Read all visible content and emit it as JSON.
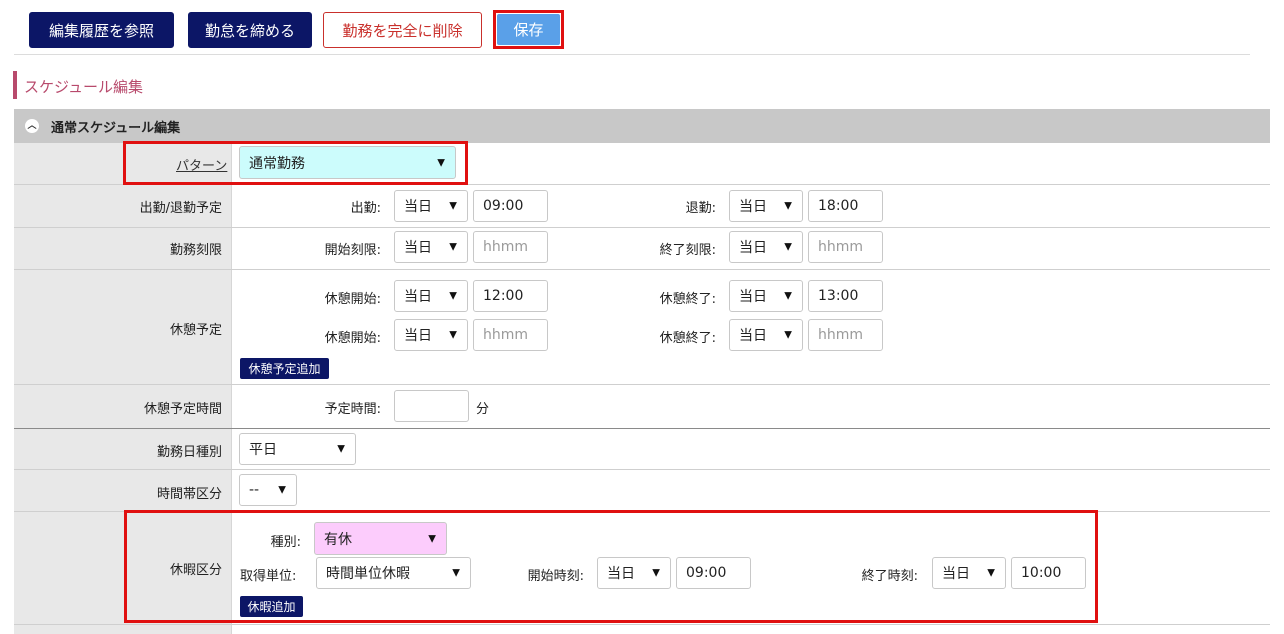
{
  "toolbar": {
    "history_label": "編集履歴を参照",
    "close_label": "勤怠を締める",
    "delete_label": "勤務を完全に削除",
    "save_label": "保存"
  },
  "section": {
    "title": "スケジュール編集"
  },
  "panel": {
    "title": "通常スケジュール編集"
  },
  "pattern": {
    "label": "パターン",
    "value": "通常勤務"
  },
  "attendance": {
    "label": "出勤/退勤予定",
    "in_label": "出勤:",
    "in_day": "当日",
    "in_time": "09:00",
    "out_label": "退勤:",
    "out_day": "当日",
    "out_time": "18:00"
  },
  "limits": {
    "label": "勤務刻限",
    "start_label": "開始刻限:",
    "start_day": "当日",
    "start_placeholder": "hhmm",
    "end_label": "終了刻限:",
    "end_day": "当日",
    "end_placeholder": "hhmm"
  },
  "breaks": {
    "label": "休憩予定",
    "rows": [
      {
        "start_label": "休憩開始:",
        "start_day": "当日",
        "start_time": "12:00",
        "end_label": "休憩終了:",
        "end_day": "当日",
        "end_time": "13:00"
      },
      {
        "start_label": "休憩開始:",
        "start_day": "当日",
        "start_placeholder": "hhmm",
        "end_label": "休憩終了:",
        "end_day": "当日",
        "end_placeholder": "hhmm"
      }
    ],
    "add_label": "休憩予定追加"
  },
  "break_time": {
    "label": "休憩予定時間",
    "field_label": "予定時間:",
    "value": "",
    "unit": "分"
  },
  "day_type": {
    "label": "勤務日種別",
    "value": "平日"
  },
  "time_zone": {
    "label": "時間帯区分",
    "value": "--"
  },
  "leave": {
    "label": "休暇区分",
    "type_label": "種別:",
    "type_value": "有休",
    "unit_label": "取得単位:",
    "unit_value": "時間単位休暇",
    "start_label": "開始時刻:",
    "start_day": "当日",
    "start_time": "09:00",
    "end_label": "終了時刻:",
    "end_day": "当日",
    "end_time": "10:00",
    "add_label": "休暇追加"
  },
  "colors": {
    "navy": "#0c1666",
    "danger": "#c9302c",
    "save_blue": "#5aa0e8",
    "highlight": "#e01010",
    "pattern_bg": "#ccfcfc",
    "leave_bg": "#fcccfc"
  }
}
